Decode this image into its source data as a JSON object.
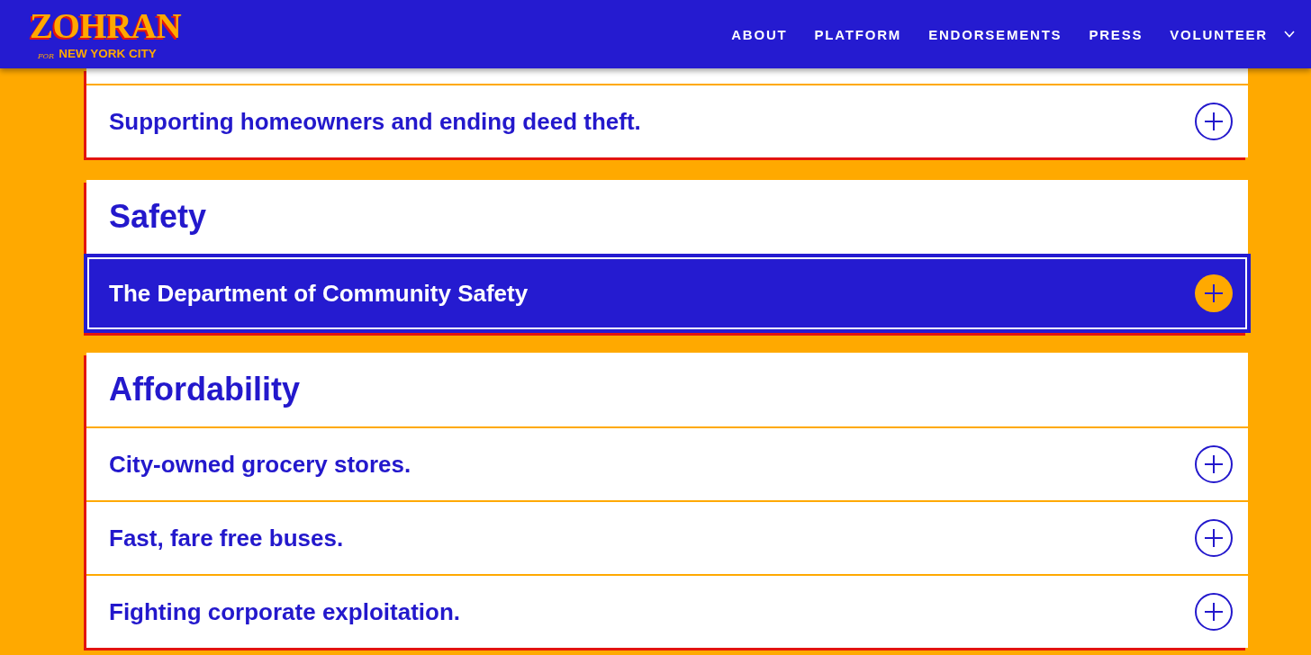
{
  "header": {
    "logo": {
      "wordmark": "ZOHRAN",
      "for": "FOR",
      "city": "NEW YORK CITY"
    },
    "nav": [
      {
        "label": "ABOUT",
        "dropdown": false
      },
      {
        "label": "PLATFORM",
        "dropdown": false
      },
      {
        "label": "ENDORSEMENTS",
        "dropdown": false
      },
      {
        "label": "PRESS",
        "dropdown": false
      },
      {
        "label": "VOLUNTEER",
        "dropdown": true
      }
    ]
  },
  "sections": [
    {
      "items": [
        {
          "label": "Supporting homeowners and ending deed theft.",
          "selected": false
        }
      ]
    },
    {
      "heading": "Safety",
      "items": [
        {
          "label": "The Department of Community Safety",
          "selected": true
        }
      ]
    },
    {
      "heading": "Affordability",
      "items": [
        {
          "label": "City-owned grocery stores.",
          "selected": false
        },
        {
          "label": "Fast, fare free buses.",
          "selected": false
        },
        {
          "label": "Fighting corporate exploitation.",
          "selected": false
        }
      ]
    }
  ]
}
